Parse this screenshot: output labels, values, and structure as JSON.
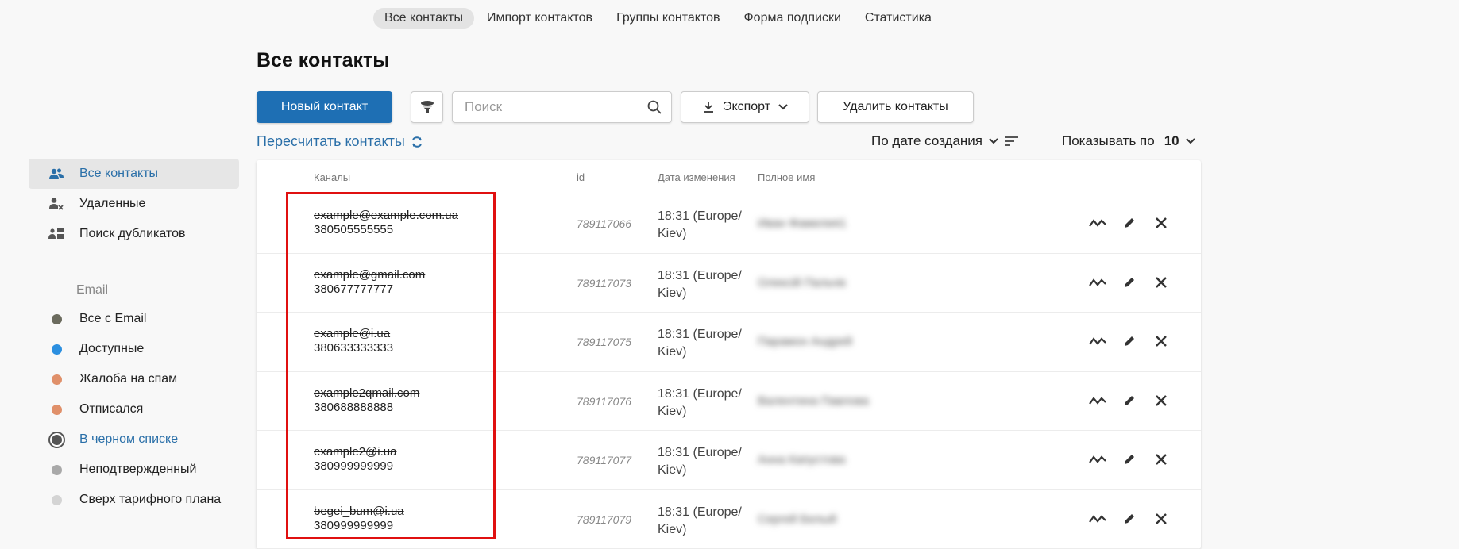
{
  "topnav": {
    "tabs": [
      {
        "label": "Все контакты",
        "active": true
      },
      {
        "label": "Импорт контактов"
      },
      {
        "label": "Группы контактов"
      },
      {
        "label": "Форма подписки"
      },
      {
        "label": "Статистика"
      }
    ]
  },
  "page_title": "Все контакты",
  "toolbar": {
    "new_contact": "Новый контакт",
    "search_placeholder": "Поиск",
    "export": "Экспорт",
    "delete": "Удалить контакты"
  },
  "recalc": "Пересчитать контакты",
  "sort": {
    "label": "По дате создания"
  },
  "perpage": {
    "label": "Показывать по",
    "value": "10"
  },
  "sidebar": {
    "items": [
      {
        "label": "Все контакты",
        "icon": "users-icon"
      },
      {
        "label": "Удаленные",
        "icon": "user-x-icon"
      },
      {
        "label": "Поиск дубликатов",
        "icon": "duplicates-icon"
      }
    ],
    "email_heading": "Email",
    "email_items": [
      {
        "label": "Все с Email",
        "color": "#6b6b5e"
      },
      {
        "label": "Доступные",
        "color": "#2b8fe0"
      },
      {
        "label": "Жалоба на спам",
        "color": "#e0906a"
      },
      {
        "label": "Отписался",
        "color": "#e0906a"
      },
      {
        "label": "В черном списке",
        "color": "#555555"
      },
      {
        "label": "Неподтвержденный",
        "color": "#a9a9a9"
      },
      {
        "label": "Сверх тарифного плана",
        "color": "#d4d4d4"
      }
    ]
  },
  "table": {
    "headers": {
      "channels": "Каналы",
      "id": "id",
      "modified": "Дата изменения",
      "fullname": "Полное имя"
    },
    "rows": [
      {
        "email": "example@example.com.ua",
        "phone": "380505555555",
        "id": "789117066",
        "date1": "18:31 (Europe/",
        "date2": "Kiev)",
        "name": "Иван Фамилия1"
      },
      {
        "email": "example@gmail.com",
        "phone": "380677777777",
        "id": "789117073",
        "date1": "18:31 (Europe/",
        "date2": "Kiev)",
        "name": "Олексій Пальчік"
      },
      {
        "email": "example@i.ua",
        "phone": "380633333333",
        "id": "789117075",
        "date1": "18:31 (Europe/",
        "date2": "Kiev)",
        "name": "Парамон Андрей"
      },
      {
        "email": "example2qmail.com",
        "phone": "380688888888",
        "id": "789117076",
        "date1": "18:31 (Europe/",
        "date2": "Kiev)",
        "name": "Валентина Павлова"
      },
      {
        "email": "example2@i.ua",
        "phone": "380999999999",
        "id": "789117077",
        "date1": "18:31 (Europe/",
        "date2": "Kiev)",
        "name": "Анна Капустова"
      },
      {
        "email": "begei_bum@i.ua",
        "phone": "380999999999",
        "id": "789117079",
        "date1": "18:31 (Europe/",
        "date2": "Kiev)",
        "name": "Сергей Белый"
      }
    ]
  },
  "colors": {
    "accent": "#1e6fb4",
    "link": "#2a6fa8",
    "highlight": "#e01010"
  }
}
